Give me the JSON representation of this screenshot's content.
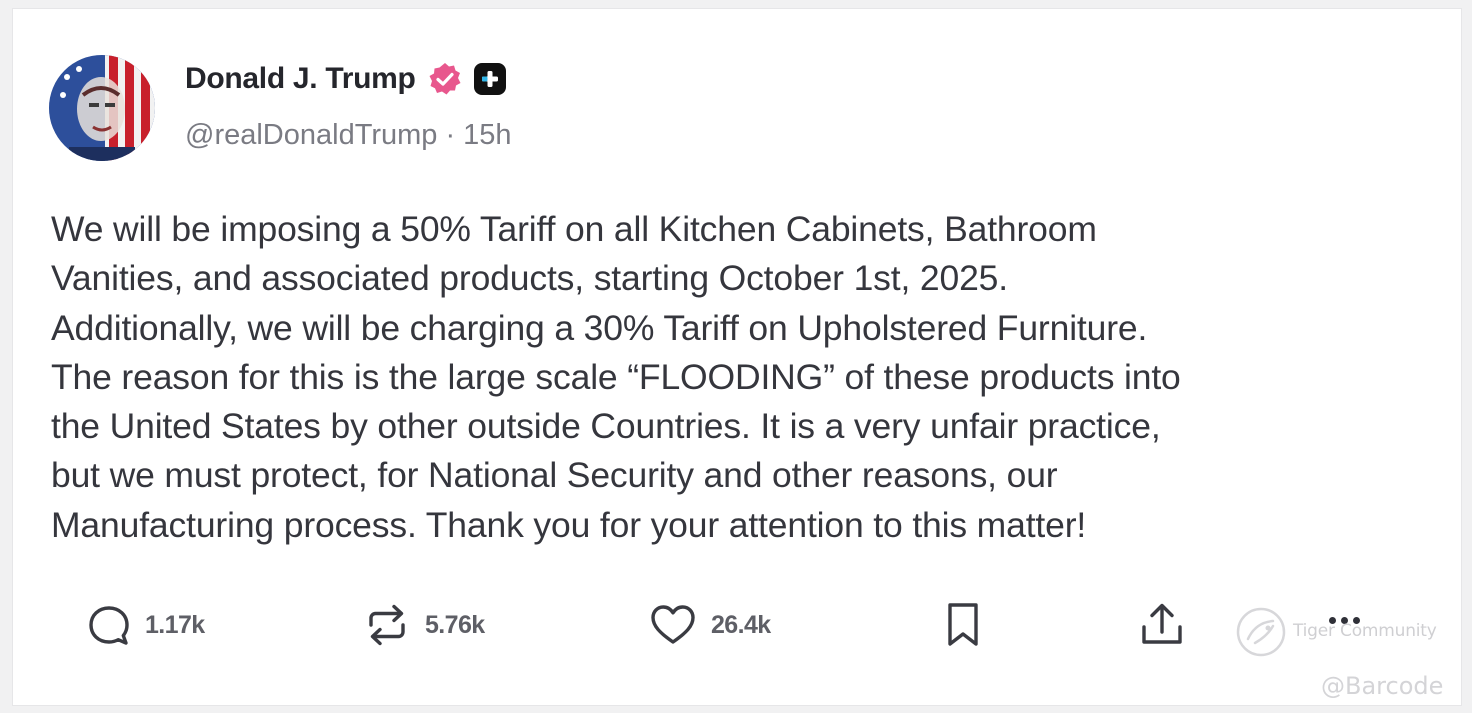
{
  "post": {
    "author_name": "Donald J. Trump",
    "handle_time": "@realDonaldTrump · 15h",
    "body": "We will be imposing a 50% Tariff on all Kitchen Cabinets, Bathroom\nVanities, and associated products, starting October 1st, 2025.\nAdditionally, we will be charging a 30% Tariff on Upholstered Furniture.\nThe reason for this is the large scale “FLOODING” of these products into\nthe United States by other outside Countries. It is a very unfair practice,\nbut we must protect, for National Security and other reasons, our\nManufacturing process. Thank you for your attention to this matter!"
  },
  "actions": {
    "replies": "1.17k",
    "reposts": "5.76k",
    "likes": "26.4k"
  },
  "watermark": {
    "community": "Tiger Community",
    "handle": "@Barcode"
  },
  "icons": {
    "verified": "verified-badge-icon",
    "plus": "plus-badge-icon",
    "reply": "reply-icon",
    "repost": "repost-icon",
    "like": "heart-icon",
    "bookmark": "bookmark-icon",
    "share": "share-icon",
    "more": "more-icon"
  },
  "colors": {
    "verified_badge": "#e8578d",
    "text": "#35363d",
    "muted": "#7a7b83"
  }
}
